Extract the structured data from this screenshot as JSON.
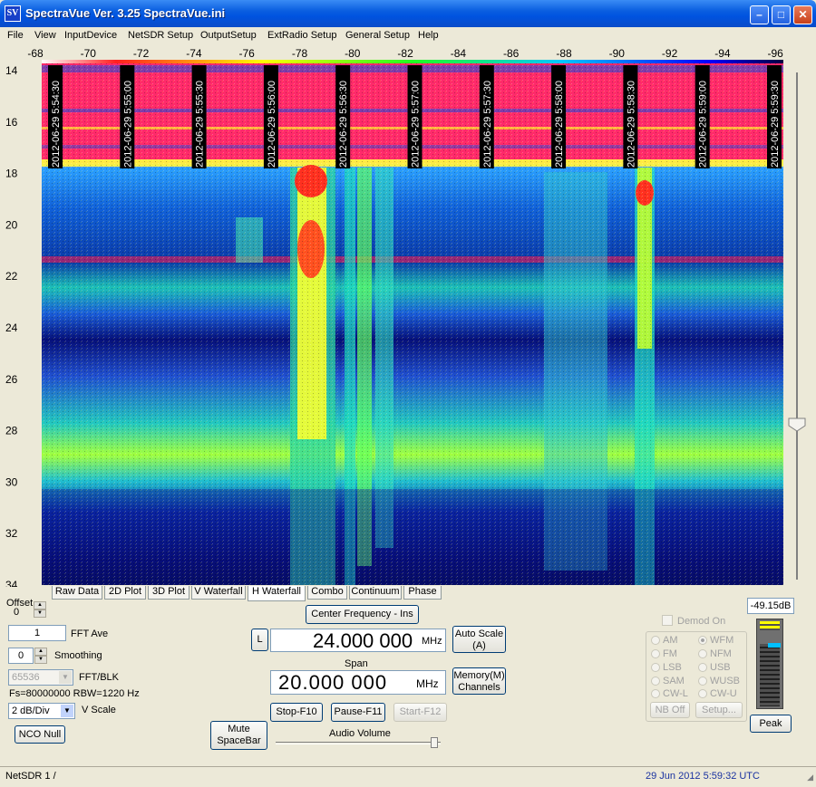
{
  "window": {
    "title": "SpectraVue Ver. 3.25  SpectraVue.ini",
    "icon_text": "SV",
    "minimize": "0",
    "maximize": "1",
    "close": "r"
  },
  "menu": [
    "File",
    "View",
    "InputDevice",
    "NetSDR Setup",
    "OutputSetup",
    "ExtRadio Setup",
    "General Setup",
    "Help"
  ],
  "x_axis_labels": [
    "-68",
    "-70",
    "-72",
    "-74",
    "-76",
    "-78",
    "-80",
    "-82",
    "-84",
    "-86",
    "-88",
    "-90",
    "-92",
    "-94",
    "-96"
  ],
  "y_axis_labels": [
    "14",
    "16",
    "18",
    "20",
    "22",
    "24",
    "26",
    "28",
    "30",
    "32",
    "34"
  ],
  "timestamps": [
    "2012-06-29 5:54:30",
    "2012-06-29 5:55:00",
    "2012-06-29 5:55:30",
    "2012-06-29 5:56:00",
    "2012-06-29 5:56:30",
    "2012-06-29 5:57:00",
    "2012-06-29 5:57:30",
    "2012-06-29 5:58:00",
    "2012-06-29 5:58:30",
    "2012-06-29 5:59:00",
    "2012-06-29 5:59:30"
  ],
  "tabs": [
    "Raw Data",
    "2D Plot",
    "3D Plot",
    "V Waterfall",
    "H Waterfall",
    "Combo",
    "Continuum",
    "Phase"
  ],
  "active_tab": "H Waterfall",
  "controls": {
    "offset_label": "Offset",
    "offset_value": "0",
    "fft_ave_value": "1",
    "fft_ave_label": "FFT Ave",
    "smoothing_value": "0",
    "smoothing_label": "Smoothing",
    "fft_blk_value": "65536",
    "fft_blk_label": "FFT/BLK",
    "fs_info": "Fs=80000000 RBW=1220 Hz",
    "vscale_value": "2 dB/Div",
    "vscale_label": "V Scale",
    "nco_null": "NCO Null",
    "mute": "Mute SpaceBar",
    "center_freq_button": "Center Frequency - Ins",
    "l_button": "L",
    "center_freq_value": "24.000 000",
    "center_freq_unit": "MHz",
    "auto_scale": "Auto Scale (A)",
    "span_label": "Span",
    "span_value": "20.000 000",
    "span_unit": "MHz",
    "memory": "Memory(M) Channels",
    "stop": "Stop-F10",
    "pause": "Pause-F11",
    "start": "Start-F12",
    "audio_volume": "Audio Volume"
  },
  "demod": {
    "demod_on": "Demod On",
    "modes": [
      "AM",
      "WFM",
      "FM",
      "NFM",
      "LSB",
      "USB",
      "SAM",
      "WUSB",
      "CW-L",
      "CW-U"
    ],
    "selected": "WFM",
    "nb_off": "NB Off",
    "setup": "Setup..."
  },
  "meter": {
    "value": "-49.15dB",
    "peak": "Peak",
    "level": 0.72
  },
  "status": {
    "device": "NetSDR 1  /",
    "datetime": "29 Jun 2012   5:59:32 UTC"
  }
}
